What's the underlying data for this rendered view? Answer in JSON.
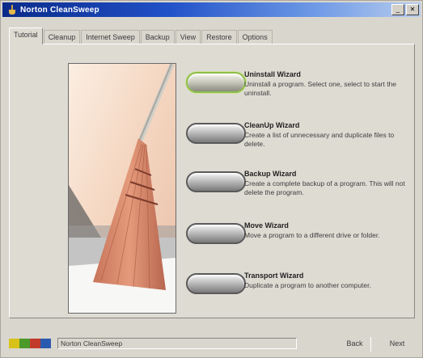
{
  "window": {
    "title": "Norton CleanSweep"
  },
  "tabs": [
    {
      "label": "Tutorial",
      "active": true
    },
    {
      "label": "Cleanup",
      "active": false
    },
    {
      "label": "Internet Sweep",
      "active": false
    },
    {
      "label": "Backup",
      "active": false
    },
    {
      "label": "View",
      "active": false
    },
    {
      "label": "Restore",
      "active": false
    },
    {
      "label": "Options",
      "active": false
    }
  ],
  "wizards": [
    {
      "title": "Uninstall Wizard",
      "description": "Uninstall a program. Select one, select to start the uninstall.",
      "focused": true
    },
    {
      "title": "CleanUp Wizard",
      "description": "Create a list of unnecessary and duplicate files to delete.",
      "focused": false
    },
    {
      "title": "Backup Wizard",
      "description": "Create a complete backup of a program. This will not delete the program.",
      "focused": false
    },
    {
      "title": "Move Wizard",
      "description": "Move a program to a different drive or folder.",
      "focused": false
    },
    {
      "title": "Transport Wizard",
      "description": "Duplicate a program to another computer.",
      "focused": false
    }
  ],
  "statusbar": {
    "text": "Norton CleanSweep"
  },
  "navigation": {
    "back_label": "Back",
    "next_label": "Next"
  },
  "colors": {
    "title_gradient_start": "#0a2a8a",
    "title_gradient_end": "#b8cdee",
    "window_background": "#d9d6ce",
    "focus_ring": "#8fbe4a",
    "logo_colors": [
      "#d8c21a",
      "#4c9a2a",
      "#c23a2a",
      "#2a5ab0"
    ]
  }
}
